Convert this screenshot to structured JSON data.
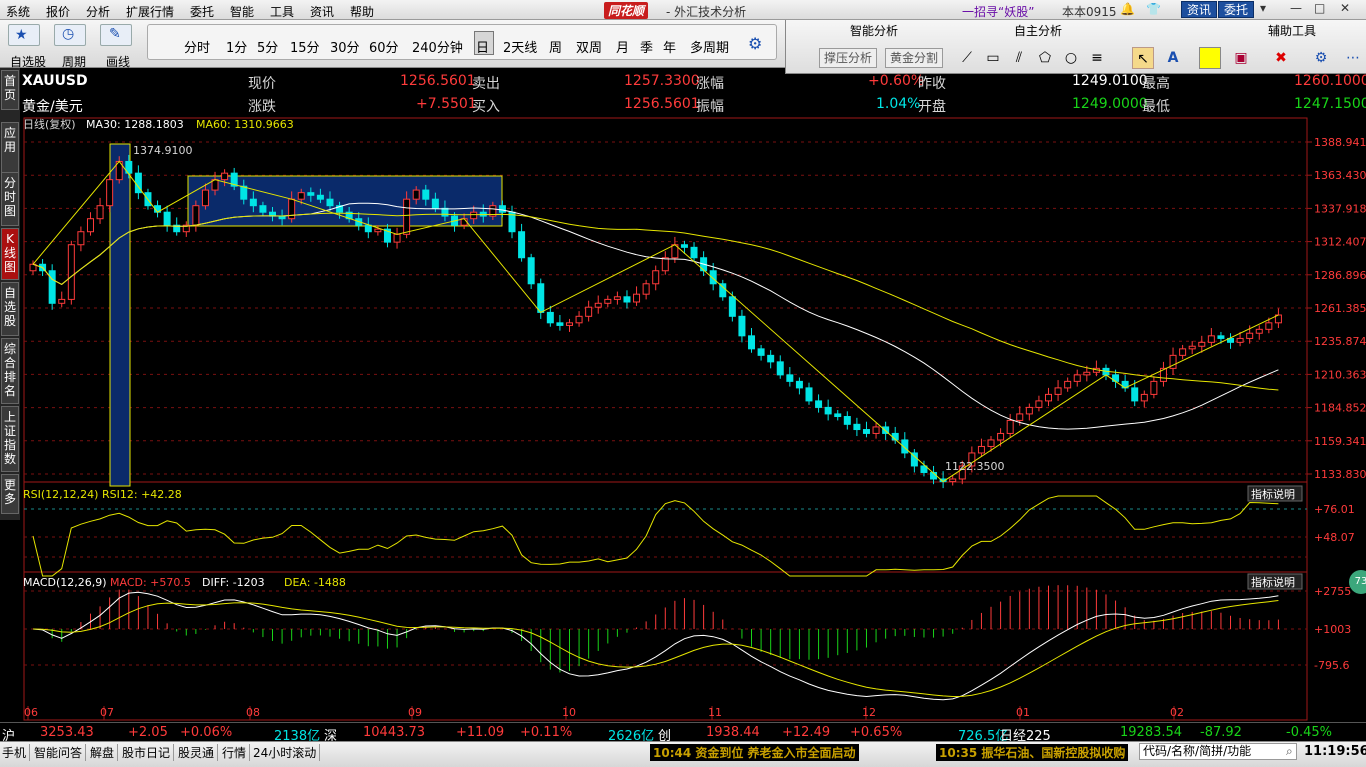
{
  "menu": {
    "items": [
      "系统",
      "报价",
      "分析",
      "扩展行情",
      "委托",
      "智能",
      "工具",
      "资讯",
      "帮助"
    ],
    "brand": "同花顺",
    "subtitle": "- 外汇技术分析",
    "promo": "一招寻“妖股”",
    "version": "本本0915",
    "btn_news": "资讯",
    "btn_trade": "委托"
  },
  "toolbar": {
    "left_labels": [
      "自选股",
      "周期",
      "画线"
    ],
    "periods": [
      "分时",
      "1分",
      "5分",
      "15分",
      "30分",
      "60分",
      "240分钟",
      "日",
      "2天线",
      "周",
      "双周",
      "月",
      "季",
      "年",
      "多周期"
    ],
    "active_period": "日"
  },
  "panel": {
    "headers": [
      "智能分析",
      "自主分析",
      "辅助工具"
    ],
    "buttons": [
      "撑压分析",
      "黄金分割"
    ],
    "tool_icons": [
      "line-tool-icon",
      "rect-tool-icon",
      "parallel-tool-icon",
      "polygon-tool-icon",
      "ellipse-tool-icon",
      "fib-tool-icon",
      "cursor-tool-icon",
      "text-tool-icon",
      "color-swatch-icon",
      "bookmark-tool-icon",
      "delete-tool-icon",
      "settings-tool-icon",
      "more-tool-icon"
    ],
    "swatch_color": "#ffff00"
  },
  "sidebar": {
    "tabs": [
      "首页",
      "应用",
      "分时图",
      "K线图",
      "自选股",
      "综合排名",
      "上证指数",
      "更多"
    ],
    "active": "K线图"
  },
  "quote": {
    "symbol": "XAUUSD",
    "name": "黄金/美元",
    "fields": [
      {
        "label": "现价",
        "value": "1256.5601",
        "label2": "卖出",
        "value2": "1257.3300",
        "label3": "涨幅",
        "value3": "+0.60%",
        "label4": "昨收",
        "value4": "1249.0100",
        "label5": "最高",
        "value5": "1260.1000"
      },
      {
        "label": "涨跌",
        "value": "+7.5501",
        "label2": "买入",
        "value2": "1256.5601",
        "label3": "振幅",
        "value3": "1.04%",
        "label4": "开盘",
        "value4": "1249.0000",
        "label5": "最低",
        "value5": "1247.1500"
      }
    ]
  },
  "indicators": {
    "main_title": "日线(复权)",
    "ma30_label": "MA30: 1288.1803",
    "ma60_label": "MA60: 1310.9663",
    "rsi_title": "RSI(12,12,24)",
    "rsi_value": "RSI12: +42.28",
    "macd_title": "MACD(12,26,9)",
    "macd_value": "MACD: +570.5",
    "diff_value": "DIFF: -1203",
    "dea_value": "DEA: -1488",
    "explain_btn": "指标说明",
    "high_marker": "1374.9100",
    "low_marker": "1122.3500",
    "colors": {
      "up": "#ff3b3b",
      "down": "#00e5e5",
      "ma30": "#ffffff",
      "ma60": "#e5e500",
      "box": "#0a2a6a"
    }
  },
  "chart_data": {
    "type": "candlestick",
    "price_axis": [
      "1388.941",
      "1363.430",
      "1337.918",
      "1312.407",
      "1286.896",
      "1261.385",
      "1235.874",
      "1210.363",
      "1184.852",
      "1159.341",
      "1133.830"
    ],
    "rsi_axis": [
      "+76.01",
      "+48.07"
    ],
    "macd_axis": [
      "+2755",
      "+1003",
      "-795.6"
    ],
    "months": [
      "06",
      "07",
      "08",
      "09",
      "10",
      "11",
      "12",
      "01",
      "02"
    ],
    "ylim": [
      1133.83,
      1388.941
    ],
    "closes": [
      1295,
      1290,
      1265,
      1268,
      1310,
      1320,
      1330,
      1340,
      1360,
      1374,
      1365,
      1350,
      1340,
      1335,
      1325,
      1320,
      1325,
      1340,
      1352,
      1360,
      1365,
      1355,
      1345,
      1340,
      1335,
      1332,
      1330,
      1345,
      1350,
      1348,
      1345,
      1340,
      1335,
      1330,
      1325,
      1320,
      1322,
      1312,
      1318,
      1345,
      1352,
      1345,
      1338,
      1332,
      1325,
      1330,
      1335,
      1332,
      1340,
      1335,
      1320,
      1300,
      1280,
      1258,
      1250,
      1248,
      1250,
      1255,
      1262,
      1265,
      1268,
      1270,
      1266,
      1272,
      1280,
      1290,
      1300,
      1310,
      1308,
      1300,
      1290,
      1280,
      1270,
      1255,
      1240,
      1230,
      1225,
      1220,
      1210,
      1205,
      1200,
      1190,
      1185,
      1180,
      1178,
      1172,
      1168,
      1165,
      1170,
      1165,
      1160,
      1150,
      1140,
      1135,
      1130,
      1128,
      1130,
      1140,
      1150,
      1155,
      1160,
      1165,
      1175,
      1180,
      1185,
      1190,
      1195,
      1200,
      1205,
      1210,
      1212,
      1215,
      1210,
      1205,
      1200,
      1190,
      1195,
      1205,
      1215,
      1225,
      1230,
      1232,
      1235,
      1240,
      1238,
      1235,
      1238,
      1242,
      1245,
      1250,
      1256
    ]
  },
  "ticker": {
    "sh_label": "沪",
    "sh_value": "3253.43",
    "sh_chg": "+2.05",
    "sh_pct": "+0.06%",
    "sh_vol": "2138亿",
    "sz_label": "深",
    "sz_value": "10443.73",
    "sz_chg": "+11.09",
    "sz_pct": "+0.11%",
    "sz_vol": "2626亿",
    "cy_label": "创",
    "cy_value": "1938.44",
    "cy_chg": "+12.49",
    "cy_pct": "+0.65%",
    "cy_vol": "726.5亿",
    "nk_label": "日经225",
    "nk_value": "19283.54",
    "nk_chg": "-87.92",
    "nk_pct": "-0.45%"
  },
  "status": {
    "items": [
      "手机",
      "智能问答",
      "解盘",
      "股市日记",
      "股灵通",
      "行情",
      "24小时滚动"
    ],
    "news1": "10:44 资金到位 养老金入市全面启动",
    "news2": "10:35 振华石油、国新控股拟收购",
    "search_placeholder": "代码/名称/简拼/功能",
    "clock": "11:19:56",
    "badge": "73"
  }
}
